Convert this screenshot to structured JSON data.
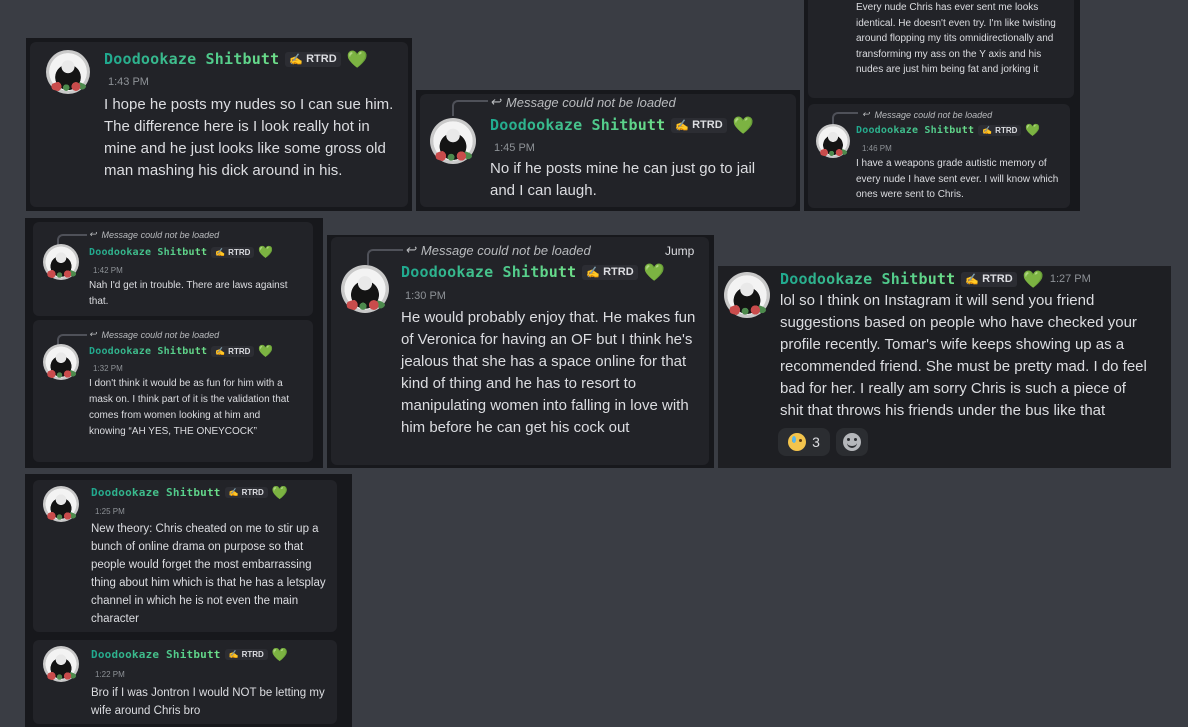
{
  "user": {
    "name": "Doodookaze Shitbutt",
    "tag_emoji": "✍",
    "tag": "RTRD",
    "heart": "💚"
  },
  "reply_placeholder": "Message could not be loaded",
  "jump_label": "Jump",
  "messages": [
    {
      "time": "1:43 PM",
      "text": "I hope he posts my nudes so I can sue him. The difference here is I look really hot in mine and he just looks like some gross old man mashing his dick around in his."
    },
    {
      "time": "1:45 PM",
      "text": "No if he posts mine he can just go to jail and I can laugh."
    },
    {
      "time": "",
      "text": "Every nude Chris has ever sent me looks identical. He doesn't even try. I'm like twisting around flopping my tits omnidirectionally and transforming my ass on the Y axis and his nudes are just him being fat and jorking it"
    },
    {
      "time": "1:46 PM",
      "text": "I have a weapons grade autistic memory of every nude I have sent ever. I will know which ones were sent to Chris."
    },
    {
      "time": "1:42 PM",
      "text": "Nah I'd get in trouble. There are laws against that."
    },
    {
      "time": "1:32 PM",
      "text": "I don't think it would be as fun for him with a mask on. I think part of it is the validation that comes from women looking at him and knowing “AH YES, THE ONEYCOCK”"
    },
    {
      "time": "1:30 PM",
      "text": "He would probably enjoy that. He makes fun of Veronica for having an OF but I think he's jealous that she has a space online for that kind of thing and he has to resort to manipulating women into falling in love with him before he can get his cock out"
    },
    {
      "time": "1:27 PM",
      "text": "lol so I think on Instagram it will send you friend suggestions based on people who have checked your profile recently. Tomar's wife keeps showing up as a recommended friend. She must be pretty mad. I do feel bad for her. I really am sorry Chris is such a piece of shit that throws his friends under the bus like that"
    },
    {
      "time": "1:25 PM",
      "text": "New theory: Chris cheated on me to stir up a bunch of online drama on purpose so that people would forget the most embarrassing thing about him which is that he has a letsplay channel in which he is not even the main character"
    },
    {
      "time": "1:22 PM",
      "text": "Bro if I was Jontron I would NOT be letting my wife around Chris bro"
    }
  ],
  "reactions": {
    "count": "3",
    "sad_emoji": "crying-face-icon",
    "add_emoji": "add-reaction-icon"
  }
}
